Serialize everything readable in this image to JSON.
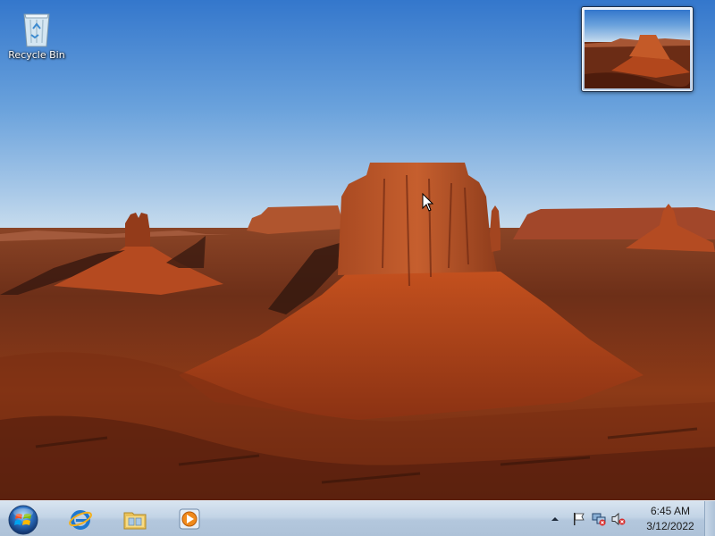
{
  "desktop": {
    "icons": [
      {
        "label": "Recycle Bin",
        "icon": "recycle-bin-icon"
      }
    ],
    "wallpaper": "desert-butte-landscape"
  },
  "taskbar": {
    "start_icon": "windows-start-orb",
    "pinned": [
      {
        "name": "Internet Explorer",
        "icon": "internet-explorer-icon"
      },
      {
        "name": "Windows Explorer",
        "icon": "folder-icon"
      },
      {
        "name": "Windows Media Player",
        "icon": "media-player-icon"
      }
    ],
    "tray": {
      "icons": [
        "show-hidden-icons-arrow",
        "action-center-flag-icon",
        "network-icon",
        "volume-muted-icon"
      ],
      "time": "6:45 AM",
      "date": "3/12/2022"
    }
  },
  "colors": {
    "sky_top": "#3a7fd0",
    "sky_horizon": "#c9dff0",
    "rock": "#b9491f",
    "taskbar": "#c3d4e6"
  }
}
